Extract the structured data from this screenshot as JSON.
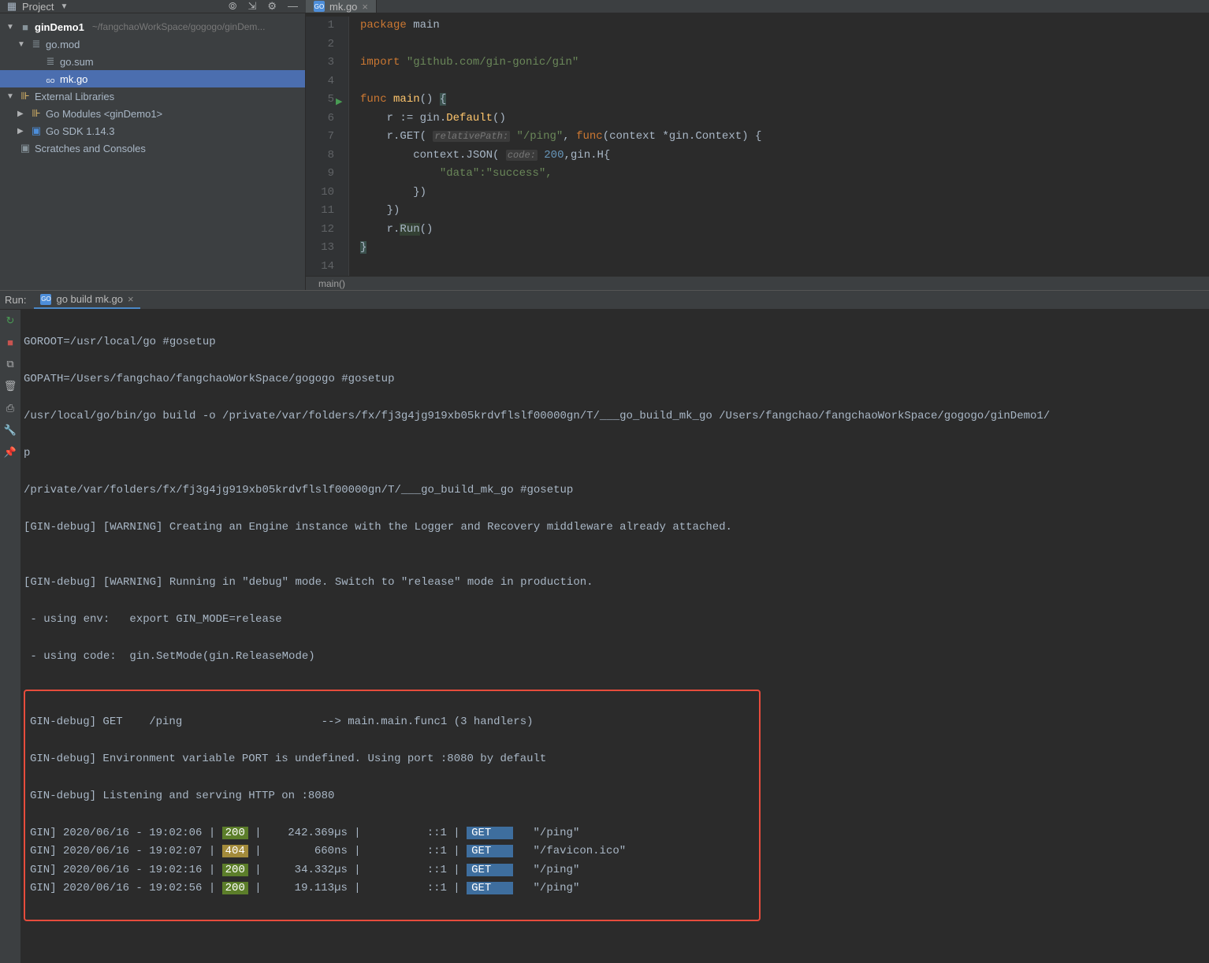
{
  "toolbar": {
    "project_label": "Project",
    "tab_file": "mk.go"
  },
  "tree": {
    "root_name": "ginDemo1",
    "root_path": "~/fangchaoWorkSpace/gogogo/ginDem...",
    "gomod": "go.mod",
    "gosum": "go.sum",
    "mkgo": "mk.go",
    "ext_lib": "External Libraries",
    "go_modules": "Go Modules <ginDemo1>",
    "go_sdk": "Go SDK 1.14.3",
    "scratches": "Scratches and Consoles"
  },
  "editor": {
    "lines": [
      "1",
      "2",
      "3",
      "4",
      "5",
      "6",
      "7",
      "8",
      "9",
      "10",
      "11",
      "12",
      "13",
      "14"
    ],
    "breadcrumb": "main()"
  },
  "code": {
    "package": "package",
    "main": "main",
    "import": "import",
    "import_path": "\"github.com/gin-gonic/gin\"",
    "func": "func",
    "main_fn": "main",
    "r_assign": "r := gin.",
    "default": "Default",
    "rget": "r.GET(",
    "hint_relpath": "relativePath:",
    "ping_path": "\"/ping\"",
    "func_kw": "func",
    "ctx_sig": "(context *gin.",
    "context_type": "Context",
    "ctx_json": "context.JSON(",
    "hint_code": "code:",
    "code_200": "200",
    "ginh": ",gin.H{",
    "data_kv": "\"data\":\"success\",",
    "rrun": "r.",
    "run_fn": "Run"
  },
  "run": {
    "label": "Run:",
    "tab": "go build mk.go",
    "lines_top": [
      "GOROOT=/usr/local/go #gosetup",
      "GOPATH=/Users/fangchao/fangchaoWorkSpace/gogogo #gosetup",
      "/usr/local/go/bin/go build -o /private/var/folders/fx/fj3g4jg919xb05krdvflslf00000gn/T/___go_build_mk_go /Users/fangchao/fangchaoWorkSpace/gogogo/ginDemo1/",
      "p",
      "/private/var/folders/fx/fj3g4jg919xb05krdvflslf00000gn/T/___go_build_mk_go #gosetup",
      "[GIN-debug] [WARNING] Creating an Engine instance with the Logger and Recovery middleware already attached.",
      "",
      "[GIN-debug] [WARNING] Running in \"debug\" mode. Switch to \"release\" mode in production.",
      " - using env:   export GIN_MODE=release",
      " - using code:  gin.SetMode(gin.ReleaseMode)"
    ],
    "box_lines_debug": [
      "GIN-debug] GET    /ping                     --> main.main.func1 (3 handlers)",
      "GIN-debug] Environment variable PORT is undefined. Using port :8080 by default",
      "GIN-debug] Listening and serving HTTP on :8080"
    ],
    "requests": [
      {
        "ts": "GIN] 2020/06/16 - 19:02:06 |",
        "code": "200",
        "lat": "   242.369µs |",
        "ip": "          ::1 |",
        "method": "GET",
        "path": "   \"/ping\""
      },
      {
        "ts": "GIN] 2020/06/16 - 19:02:07 |",
        "code": "404",
        "lat": "       660ns |",
        "ip": "          ::1 |",
        "method": "GET",
        "path": "   \"/favicon.ico\""
      },
      {
        "ts": "GIN] 2020/06/16 - 19:02:16 |",
        "code": "200",
        "lat": "    34.332µs |",
        "ip": "          ::1 |",
        "method": "GET",
        "path": "   \"/ping\""
      },
      {
        "ts": "GIN] 2020/06/16 - 19:02:56 |",
        "code": "200",
        "lat": "    19.113µs |",
        "ip": "          ::1 |",
        "method": "GET",
        "path": "   \"/ping\""
      }
    ]
  }
}
